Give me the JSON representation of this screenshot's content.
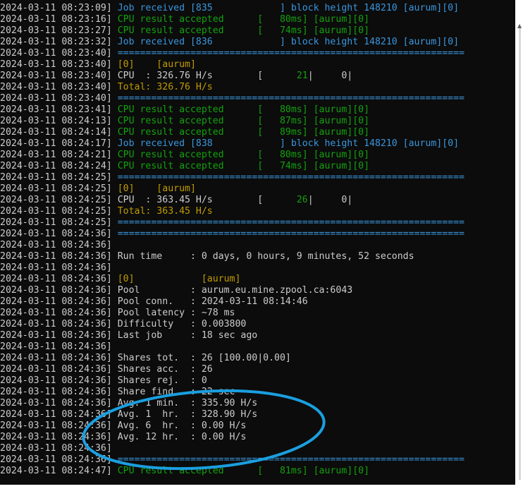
{
  "colors": {
    "background": "#0c0c0c",
    "default": "#cccccc",
    "job": "#3a96dd",
    "accepted": "#13a10e",
    "yellow": "#c19c00",
    "annotation": "#1a9fe0"
  },
  "lines": [
    [
      [
        "2024-03-11 08:23:09] ",
        "default"
      ],
      [
        "Job received [835            ] block height 148210 [aurum][0]",
        "job"
      ]
    ],
    [
      [
        "2024-03-11 08:23:16] ",
        "default"
      ],
      [
        "CPU result accepted      [   80ms] [aurum][0]",
        "accepted"
      ]
    ],
    [
      [
        "2024-03-11 08:23:27] ",
        "default"
      ],
      [
        "CPU result accepted      [   74ms] [aurum][0]",
        "accepted"
      ]
    ],
    [
      [
        "2024-03-11 08:23:32] ",
        "default"
      ],
      [
        "Job received [836            ] block height 148210 [aurum][0]",
        "job"
      ]
    ],
    [
      [
        "2024-03-11 08:23:40] ",
        "default"
      ],
      [
        "==============================================================",
        "job"
      ]
    ],
    [
      [
        "2024-03-11 08:23:40] ",
        "default"
      ],
      [
        "[0]    [aurum]",
        "yellow"
      ]
    ],
    [
      [
        "2024-03-11 08:23:40] ",
        "default"
      ],
      [
        "CPU  : 326.76 H/s        [      ",
        "default"
      ],
      [
        "21",
        "accepted"
      ],
      [
        "|     0|",
        "default"
      ]
    ],
    [
      [
        "2024-03-11 08:23:40] ",
        "default"
      ],
      [
        "Total: 326.76 H/s",
        "yellow"
      ]
    ],
    [
      [
        "2024-03-11 08:23:40] ",
        "default"
      ],
      [
        "==============================================================",
        "job"
      ]
    ],
    [
      [
        "2024-03-11 08:23:41] ",
        "default"
      ],
      [
        "CPU result accepted      [   80ms] [aurum][0]",
        "accepted"
      ]
    ],
    [
      [
        "2024-03-11 08:24:13] ",
        "default"
      ],
      [
        "CPU result accepted      [   87ms] [aurum][0]",
        "accepted"
      ]
    ],
    [
      [
        "2024-03-11 08:24:14] ",
        "default"
      ],
      [
        "CPU result accepted      [   89ms] [aurum][0]",
        "accepted"
      ]
    ],
    [
      [
        "2024-03-11 08:24:17] ",
        "default"
      ],
      [
        "Job received [838            ] block height 148210 [aurum][0]",
        "job"
      ]
    ],
    [
      [
        "2024-03-11 08:24:21] ",
        "default"
      ],
      [
        "CPU result accepted      [   80ms] [aurum][0]",
        "accepted"
      ]
    ],
    [
      [
        "2024-03-11 08:24:24] ",
        "default"
      ],
      [
        "CPU result accepted      [   74ms] [aurum][0]",
        "accepted"
      ]
    ],
    [
      [
        "2024-03-11 08:24:25] ",
        "default"
      ],
      [
        "==============================================================",
        "job"
      ]
    ],
    [
      [
        "2024-03-11 08:24:25] ",
        "default"
      ],
      [
        "[0]    [aurum]",
        "yellow"
      ]
    ],
    [
      [
        "2024-03-11 08:24:25] ",
        "default"
      ],
      [
        "CPU  : 363.45 H/s        [      ",
        "default"
      ],
      [
        "26",
        "accepted"
      ],
      [
        "|     0|",
        "default"
      ]
    ],
    [
      [
        "2024-03-11 08:24:25] ",
        "default"
      ],
      [
        "Total: 363.45 H/s",
        "yellow"
      ]
    ],
    [
      [
        "2024-03-11 08:24:25] ",
        "default"
      ],
      [
        "==============================================================",
        "job"
      ]
    ],
    [
      [
        "2024-03-11 08:24:36] ",
        "default"
      ],
      [
        "==============================================================",
        "job"
      ]
    ],
    [
      [
        "2024-03-11 08:24:36]",
        "default"
      ]
    ],
    [
      [
        "2024-03-11 08:24:36] ",
        "default"
      ],
      [
        "Run time     : 0 days, 0 hours, 9 minutes, 52 seconds",
        "default"
      ]
    ],
    [
      [
        "2024-03-11 08:24:36]",
        "default"
      ]
    ],
    [
      [
        "2024-03-11 08:24:36] ",
        "default"
      ],
      [
        "[0]            [aurum]",
        "yellow"
      ]
    ],
    [
      [
        "2024-03-11 08:24:36] ",
        "default"
      ],
      [
        "Pool         : aurum.eu.mine.zpool.ca:6043",
        "default"
      ]
    ],
    [
      [
        "2024-03-11 08:24:36] ",
        "default"
      ],
      [
        "Pool conn.   : 2024-03-11 08:14:46",
        "default"
      ]
    ],
    [
      [
        "2024-03-11 08:24:36] ",
        "default"
      ],
      [
        "Pool latency : ~78 ms",
        "default"
      ]
    ],
    [
      [
        "2024-03-11 08:24:36] ",
        "default"
      ],
      [
        "Difficulty   : 0.003800",
        "default"
      ]
    ],
    [
      [
        "2024-03-11 08:24:36] ",
        "default"
      ],
      [
        "Last job     : 18 sec ago",
        "default"
      ]
    ],
    [
      [
        "2024-03-11 08:24:36]",
        "default"
      ]
    ],
    [
      [
        "2024-03-11 08:24:36] ",
        "default"
      ],
      [
        "Shares tot.  : 26 [100.00|0.00]",
        "default"
      ]
    ],
    [
      [
        "2024-03-11 08:24:36] ",
        "default"
      ],
      [
        "Shares acc.  : 26",
        "default"
      ]
    ],
    [
      [
        "2024-03-11 08:24:36] ",
        "default"
      ],
      [
        "Shares rej.  : 0",
        "default"
      ]
    ],
    [
      [
        "2024-03-11 08:24:36] ",
        "default"
      ],
      [
        "Share find   : 22 sec",
        "default"
      ]
    ],
    [
      [
        "2024-03-11 08:24:36] ",
        "default"
      ],
      [
        "Avg. 1 min.  : 335.90 H/s",
        "default"
      ]
    ],
    [
      [
        "2024-03-11 08:24:36] ",
        "default"
      ],
      [
        "Avg. 1  hr.  : 328.90 H/s",
        "default"
      ]
    ],
    [
      [
        "2024-03-11 08:24:36] ",
        "default"
      ],
      [
        "Avg. 6  hr.  : 0.00 H/s",
        "default"
      ]
    ],
    [
      [
        "2024-03-11 08:24:36] ",
        "default"
      ],
      [
        "Avg. 12 hr.  : 0.00 H/s",
        "default"
      ]
    ],
    [
      [
        "2024-03-11 08:24:36]",
        "default"
      ]
    ],
    [
      [
        "2024-03-11 08:24:36] ",
        "default"
      ],
      [
        "==============================================================",
        "job"
      ]
    ],
    [
      [
        "2024-03-11 08:24:47] ",
        "default"
      ],
      [
        "CPU result accepted      [   81ms] [aurum][0]",
        "accepted"
      ]
    ]
  ],
  "icons": {
    "scroll_up": "triangle-up-icon"
  }
}
